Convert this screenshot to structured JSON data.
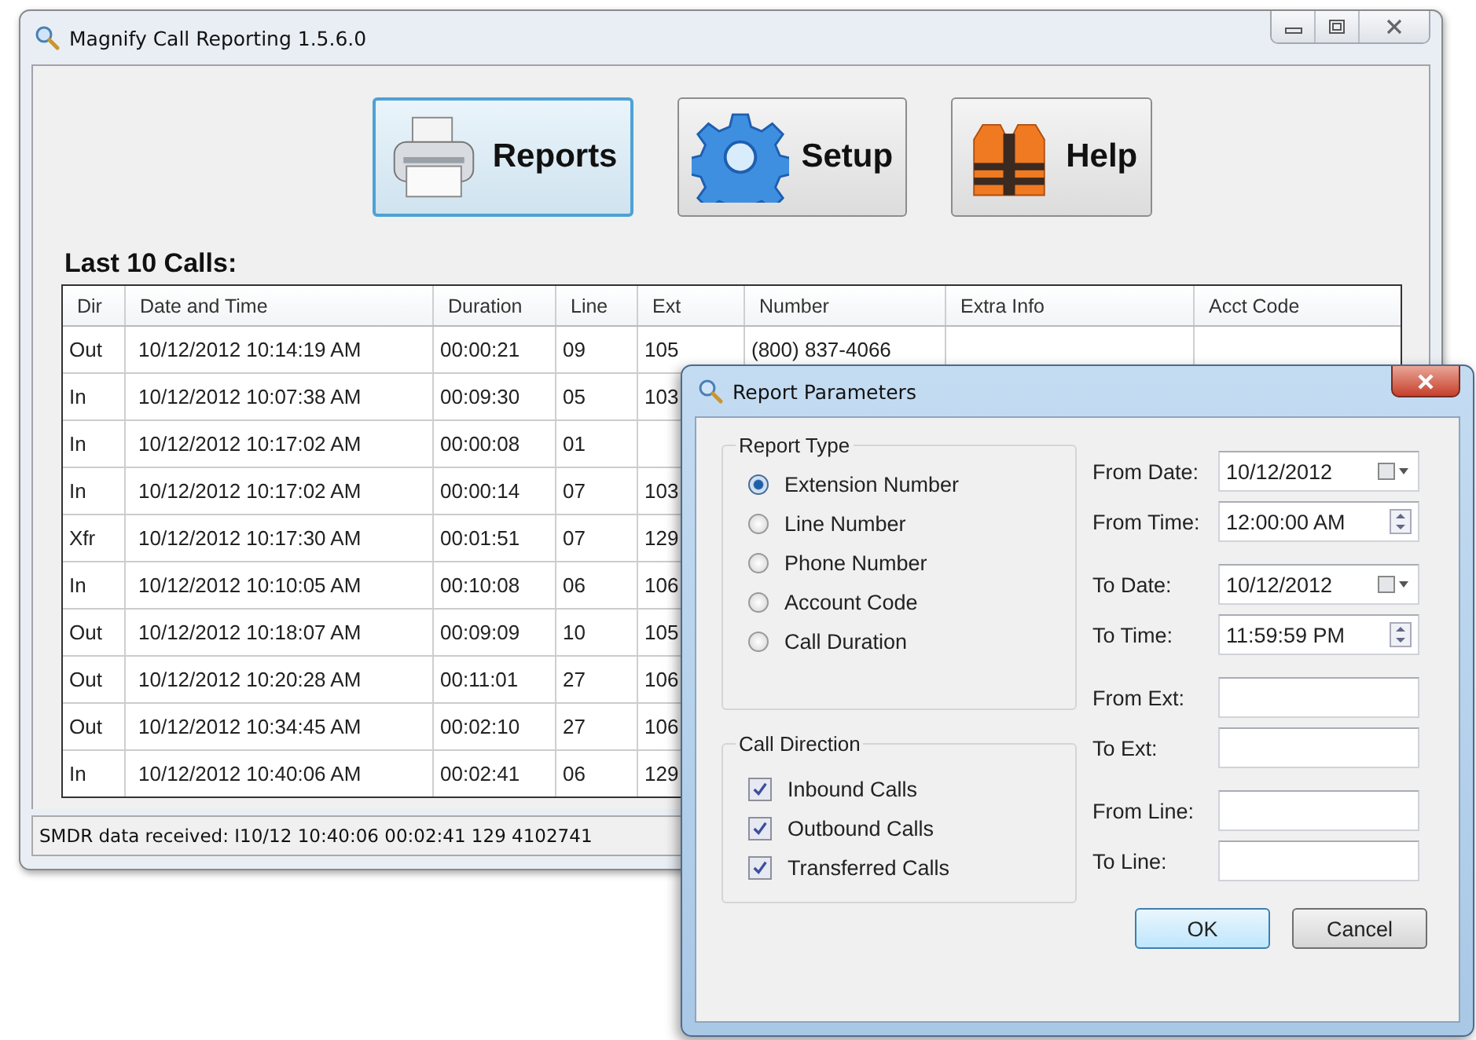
{
  "window": {
    "title": "Magnify Call Reporting 1.5.6.0"
  },
  "toolbar": [
    {
      "label": "Reports",
      "kind": "printer",
      "selected": true
    },
    {
      "label": "Setup",
      "kind": "gear",
      "selected": false
    },
    {
      "label": "Help",
      "kind": "vest",
      "selected": false
    }
  ],
  "calls": {
    "title": "Last 10 Calls:",
    "columns": [
      "Dir",
      "Date and Time",
      "Duration",
      "Line",
      "Ext",
      "Number",
      "Extra Info",
      "Acct Code"
    ],
    "rows": [
      {
        "dir": "Out",
        "date_time": "10/12/2012 10:14:19 AM",
        "duration": "00:00:21",
        "line": "09",
        "ext": "105",
        "number": "(800) 837-4066"
      },
      {
        "dir": "In",
        "date_time": "10/12/2012 10:07:38 AM",
        "duration": "00:09:30",
        "line": "05",
        "ext": "103"
      },
      {
        "dir": "In",
        "date_time": "10/12/2012 10:17:02 AM",
        "duration": "00:00:08",
        "line": "01"
      },
      {
        "dir": "In",
        "date_time": "10/12/2012 10:17:02 AM",
        "duration": "00:00:14",
        "line": "07",
        "ext": "103"
      },
      {
        "dir": "Xfr",
        "date_time": "10/12/2012 10:17:30 AM",
        "duration": "00:01:51",
        "line": "07",
        "ext": "129"
      },
      {
        "dir": "In",
        "date_time": "10/12/2012 10:10:05 AM",
        "duration": "00:10:08",
        "line": "06",
        "ext": "106"
      },
      {
        "dir": "Out",
        "date_time": "10/12/2012 10:18:07 AM",
        "duration": "00:09:09",
        "line": "10",
        "ext": "105"
      },
      {
        "dir": "Out",
        "date_time": "10/12/2012 10:20:28 AM",
        "duration": "00:11:01",
        "line": "27",
        "ext": "106"
      },
      {
        "dir": "Out",
        "date_time": "10/12/2012 10:34:45 AM",
        "duration": "00:02:10",
        "line": "27",
        "ext": "106"
      },
      {
        "dir": "In",
        "date_time": "10/12/2012 10:40:06 AM",
        "duration": "00:02:41",
        "line": "06",
        "ext": "129"
      }
    ]
  },
  "status_bar": "SMDR data received: I10/12 10:40:06 00:02:41 129 4102741",
  "dialog": {
    "title": "Report Parameters",
    "report_type": {
      "title": "Report Type",
      "options": [
        {
          "label": "Extension Number",
          "selected": true
        },
        {
          "label": "Line Number",
          "selected": false
        },
        {
          "label": "Phone Number",
          "selected": false
        },
        {
          "label": "Account Code",
          "selected": false
        },
        {
          "label": "Call Duration",
          "selected": false
        }
      ]
    },
    "call_direction": {
      "title": "Call Direction",
      "options": [
        {
          "label": "Inbound Calls",
          "checked": true
        },
        {
          "label": "Outbound Calls",
          "checked": true
        },
        {
          "label": "Transferred Calls",
          "checked": true
        }
      ]
    },
    "field_groups": [
      [
        {
          "label": "From Date:",
          "value": "10/12/2012",
          "kind": "date"
        },
        {
          "label": "From Time:",
          "value": "12:00:00 AM",
          "kind": "time"
        }
      ],
      [
        {
          "label": "To Date:",
          "value": "10/12/2012",
          "kind": "date"
        },
        {
          "label": "To Time:",
          "value": "11:59:59 PM",
          "kind": "time"
        }
      ],
      [
        {
          "label": "From Ext:",
          "kind": "text"
        },
        {
          "label": "To Ext:",
          "kind": "text"
        }
      ],
      [
        {
          "label": "From Line:",
          "kind": "text"
        },
        {
          "label": "To Line:",
          "kind": "text"
        }
      ]
    ],
    "buttons": [
      {
        "label": "OK",
        "default": true
      },
      {
        "label": "Cancel",
        "default": false
      }
    ]
  }
}
